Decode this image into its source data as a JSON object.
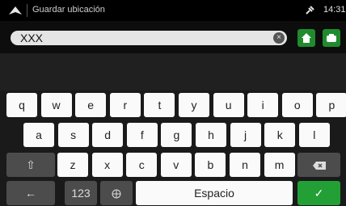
{
  "status_bar": {
    "title": "Guardar ubicación",
    "clock": "14:31"
  },
  "search": {
    "value": "XXX",
    "clear_glyph": "×"
  },
  "keyboard": {
    "row1": [
      "q",
      "w",
      "e",
      "r",
      "t",
      "y",
      "u",
      "i",
      "o",
      "p"
    ],
    "row2": [
      "a",
      "s",
      "d",
      "f",
      "g",
      "h",
      "j",
      "k",
      "l"
    ],
    "row3": [
      "z",
      "x",
      "c",
      "v",
      "b",
      "n",
      "m"
    ],
    "back_glyph": "←",
    "numbers_label": "123",
    "space_label": "Espacio",
    "confirm_glyph": "✓",
    "shift_glyph": "⇧"
  },
  "colors": {
    "accent": "#22a035",
    "keys": "#fafafa",
    "dark_keys": "#4c4c4c"
  },
  "icons": [
    "navigation-arrow-icon",
    "gps-satellite-icon",
    "clear-icon",
    "home-icon",
    "work-icon",
    "globe-icon",
    "backspace-icon",
    "checkmark-icon"
  ]
}
